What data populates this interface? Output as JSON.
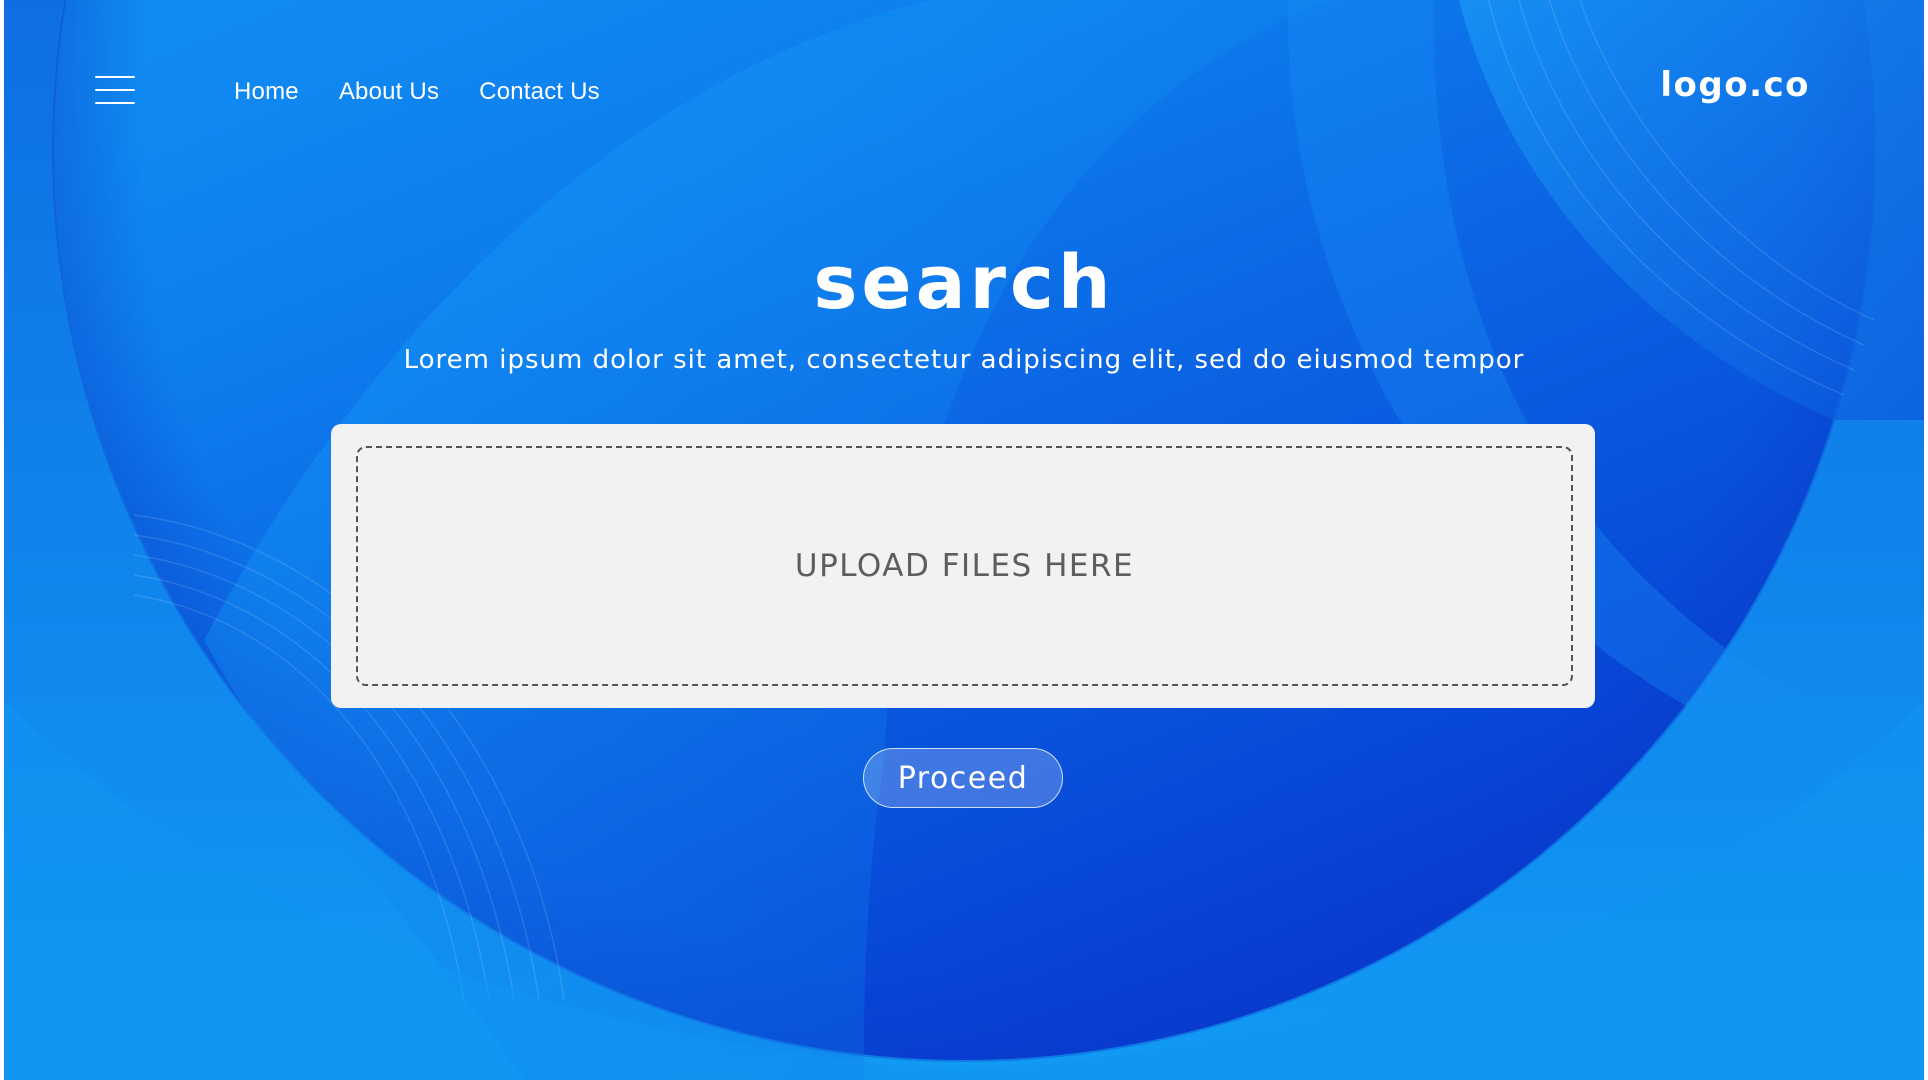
{
  "header": {
    "menu_icon": "hamburger-menu-icon",
    "nav": [
      {
        "label": "Home"
      },
      {
        "label": "About Us"
      },
      {
        "label": "Contact Us"
      }
    ],
    "logo": "logo.co"
  },
  "hero": {
    "title": "search",
    "subtitle": "Lorem ipsum dolor sit amet, consectetur adipiscing elit, sed do eiusmod tempor"
  },
  "upload": {
    "label": "UPLOAD FILES HERE"
  },
  "actions": {
    "proceed_label": "Proceed"
  },
  "colors": {
    "background": "#0f72e6",
    "circle_light": "#14a6fb",
    "circle_dark": "#0632cc",
    "card": "#f2f2f2",
    "upload_text": "#5d5d5d",
    "text": "#ffffff"
  }
}
